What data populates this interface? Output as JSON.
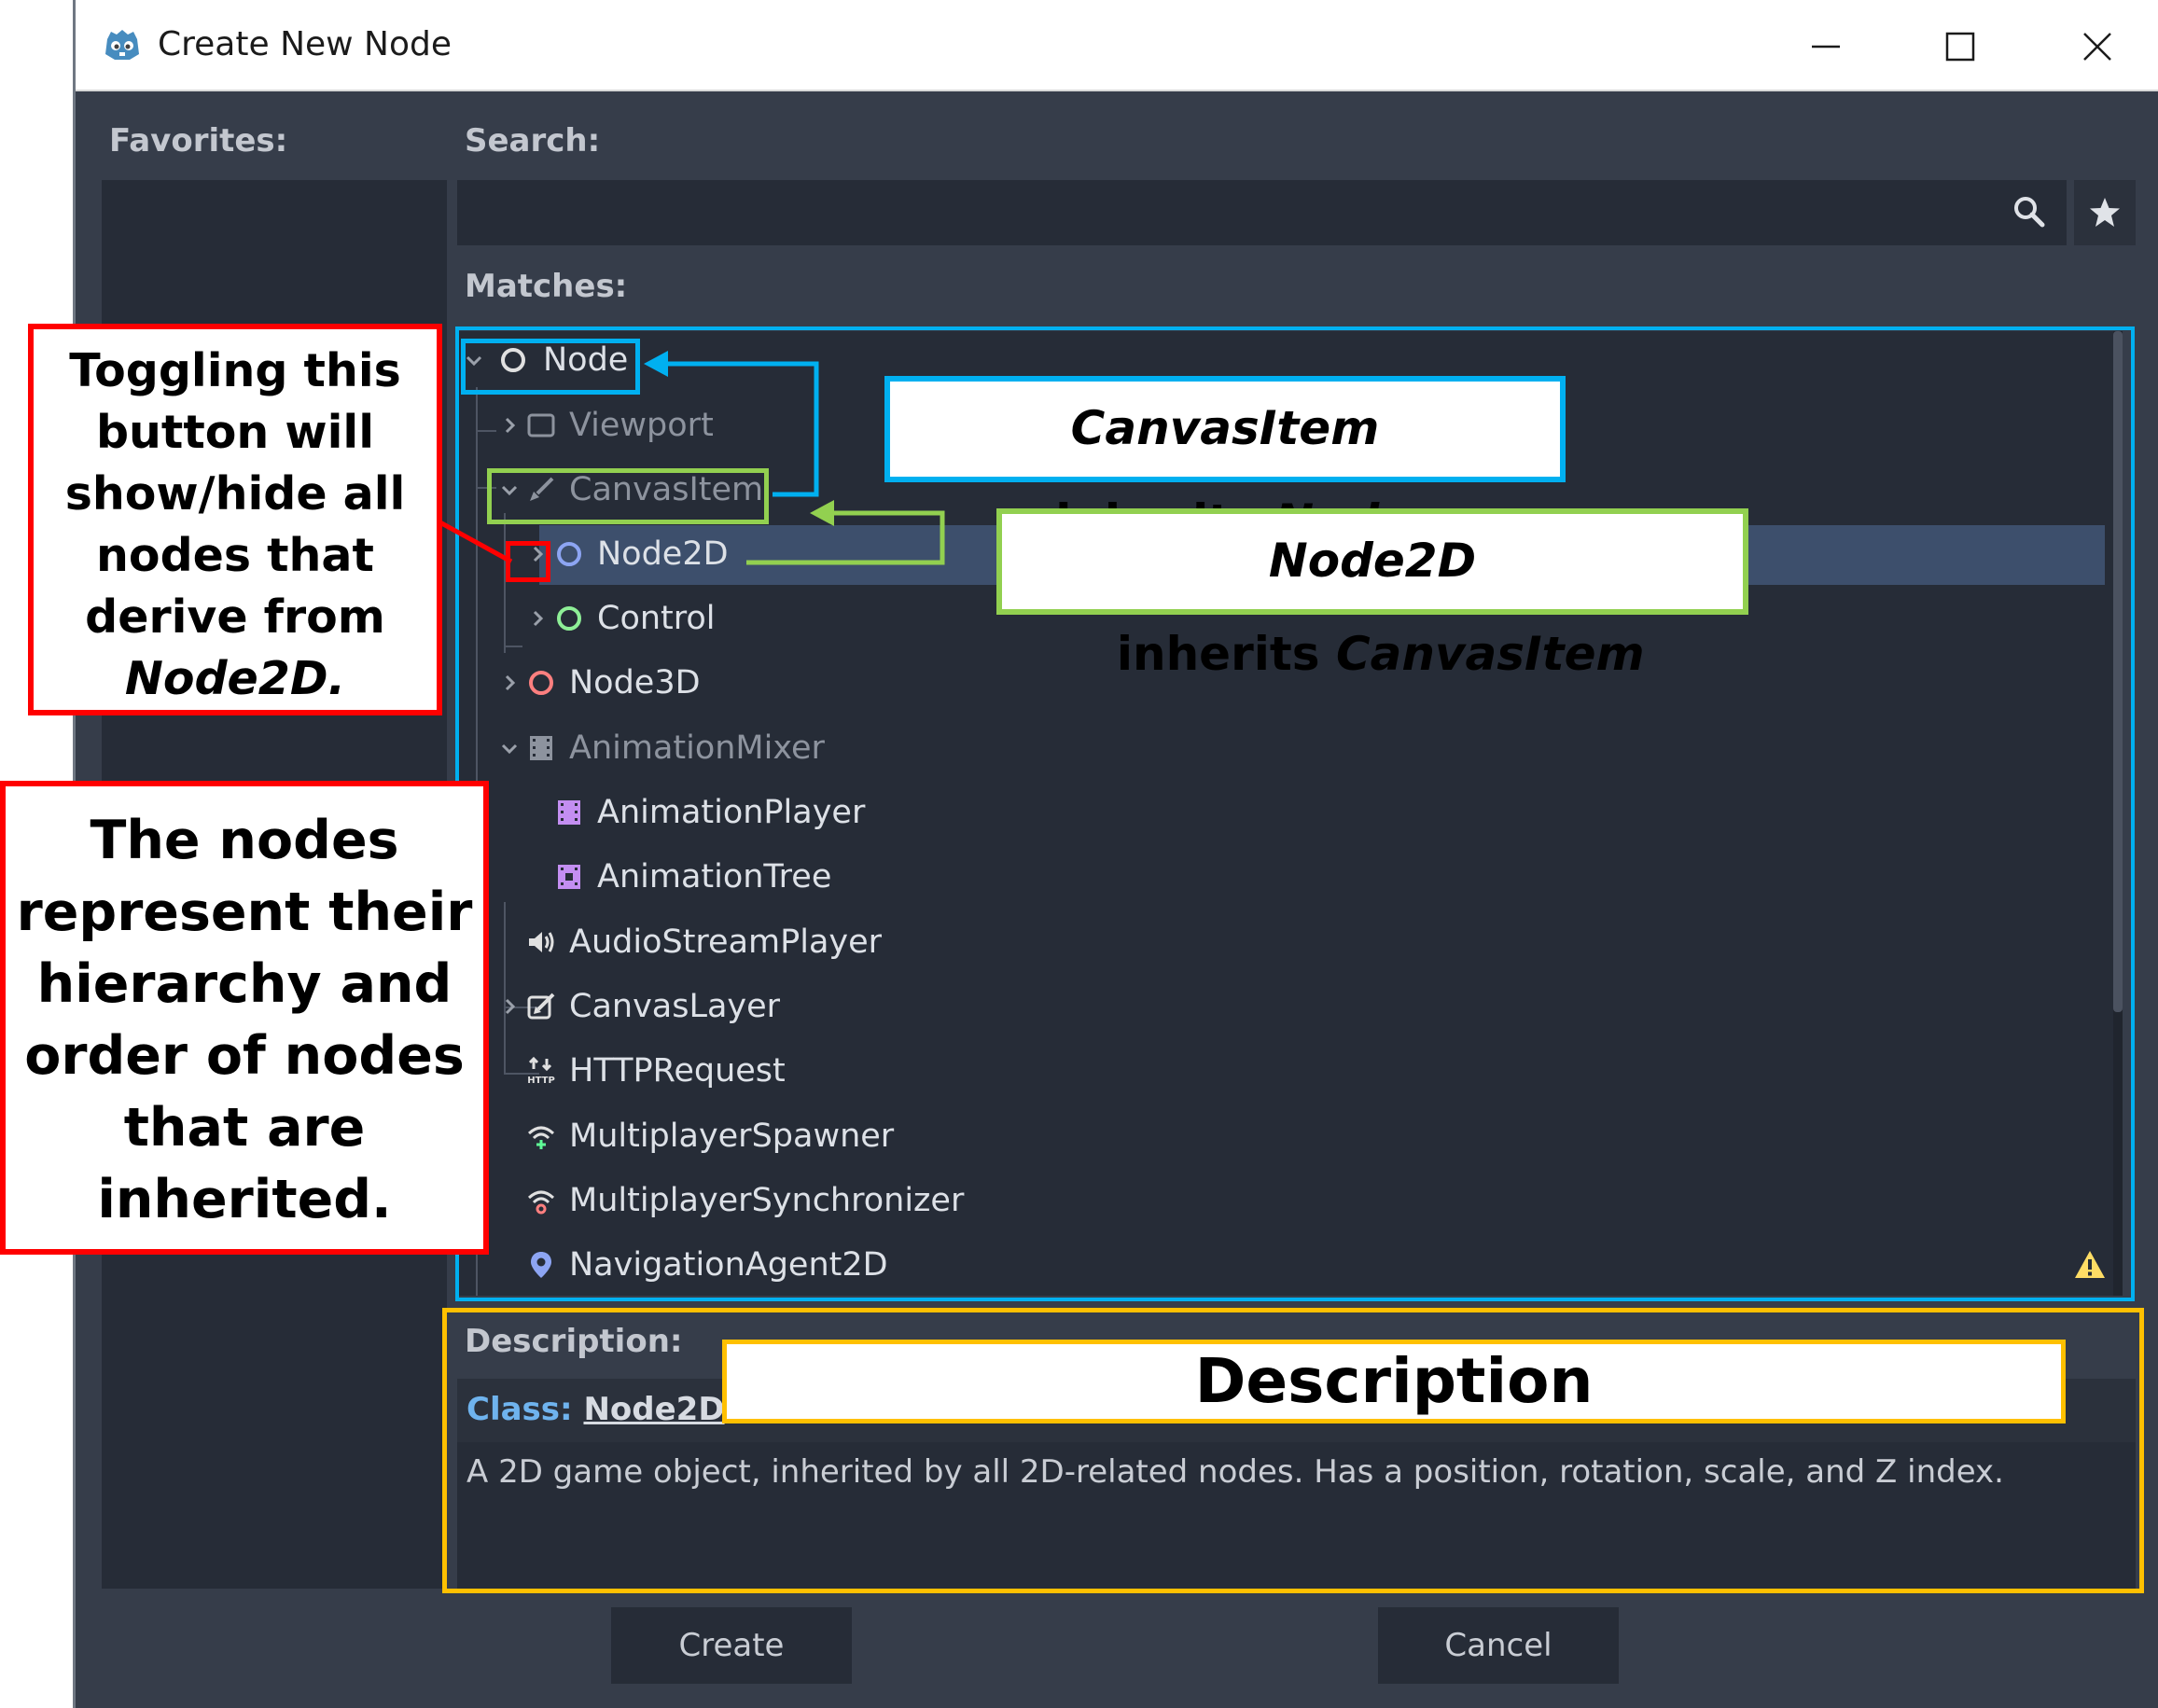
{
  "window": {
    "title": "Create New Node",
    "controls": [
      "minimize",
      "maximize",
      "close"
    ]
  },
  "favorites": {
    "label": "Favorites:"
  },
  "search": {
    "label": "Search:",
    "value": "",
    "icon": "search-icon",
    "favorite_icon": "star-icon"
  },
  "matches": {
    "label": "Matches:",
    "items": [
      {
        "name": "Node",
        "icon": "node-circle-icon",
        "expanded": true,
        "dim": false
      },
      {
        "name": "Viewport",
        "icon": "viewport-icon",
        "expanded": false,
        "dim": true
      },
      {
        "name": "CanvasItem",
        "icon": "brush-icon",
        "expanded": true,
        "dim": true
      },
      {
        "name": "Node2D",
        "icon": "node2d-circle-icon",
        "expanded": false,
        "dim": false,
        "selected": true
      },
      {
        "name": "Control",
        "icon": "control-circle-icon",
        "expanded": false,
        "dim": false
      },
      {
        "name": "Node3D",
        "icon": "node3d-circle-icon",
        "expanded": false,
        "dim": false
      },
      {
        "name": "AnimationMixer",
        "icon": "film-icon",
        "expanded": true,
        "dim": true
      },
      {
        "name": "AnimationPlayer",
        "icon": "animation-player-icon",
        "dim": false
      },
      {
        "name": "AnimationTree",
        "icon": "animation-tree-icon",
        "dim": false
      },
      {
        "name": "AudioStreamPlayer",
        "icon": "speaker-icon",
        "dim": false
      },
      {
        "name": "CanvasLayer",
        "icon": "canvas-layer-icon",
        "expanded": false,
        "dim": false
      },
      {
        "name": "HTTPRequest",
        "icon": "http-icon",
        "dim": false
      },
      {
        "name": "MultiplayerSpawner",
        "icon": "wifi-plus-icon",
        "dim": false
      },
      {
        "name": "MultiplayerSynchronizer",
        "icon": "wifi-sync-icon",
        "dim": false
      },
      {
        "name": "NavigationAgent2D",
        "icon": "map-pin-icon",
        "dim": false,
        "warning": true
      }
    ]
  },
  "description": {
    "label": "Description:",
    "class_key": "Class:",
    "class_name": "Node2D",
    "text": "A 2D game object, inherited by all 2D-related nodes. Has a position, rotation, scale, and Z index."
  },
  "buttons": {
    "create": "Create",
    "cancel": "Cancel"
  },
  "annotations": {
    "toggle_note": [
      "Toggling this",
      "button will",
      "show/hide all",
      "nodes that",
      "derive from",
      "Node2D."
    ],
    "hierarchy_note": [
      "The nodes",
      "represent their",
      "hierarchy and",
      "order of nodes",
      "that are",
      "inherited."
    ],
    "canvasitem_note": {
      "a": "CanvasItem",
      "mid": " inherits ",
      "b": "Node"
    },
    "node2d_note": {
      "a": "Node2D",
      "mid": " inherits ",
      "b": "CanvasItem"
    },
    "description_note": "Description"
  },
  "colors": {
    "window_bg": "#363d4a",
    "panel_bg": "#262c37",
    "selection": "#3d4f6c",
    "annotation_red": "#ff0000",
    "annotation_blue": "#00b0f0",
    "annotation_green": "#92d050",
    "annotation_gold": "#ffc000"
  }
}
